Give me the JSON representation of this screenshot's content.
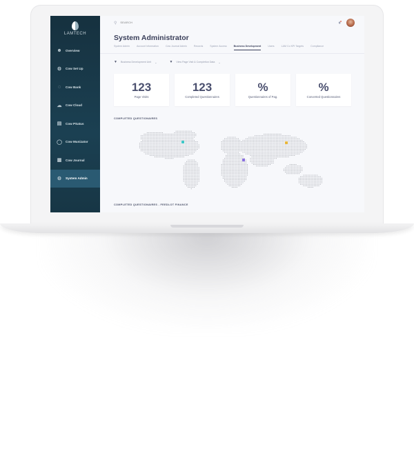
{
  "app": {
    "logo_text": "LAMTECH"
  },
  "sidebar": {
    "items": [
      {
        "label": "Overview",
        "icon": "person-icon"
      },
      {
        "label": "Cow Set Up",
        "icon": "cow-icon"
      },
      {
        "label": "Cow Bank",
        "icon": "piggy-bank-icon"
      },
      {
        "label": "Cow Cloud",
        "icon": "cloud-icon"
      },
      {
        "label": "Cow PSatus",
        "icon": "document-icon"
      },
      {
        "label": "Cow Munizator",
        "icon": "chat-icon"
      },
      {
        "label": "Cow Journal",
        "icon": "journal-icon"
      },
      {
        "label": "System Admin",
        "icon": "gear-icon",
        "active": true
      }
    ]
  },
  "topbar": {
    "search_placeholder": "SEARCH"
  },
  "page": {
    "title": "System Administrator"
  },
  "tabs": [
    {
      "label": "System Admin"
    },
    {
      "label": "Account Information"
    },
    {
      "label": "Cow Journal Admin"
    },
    {
      "label": "Records"
    },
    {
      "label": "System Access"
    },
    {
      "label": "Business Development",
      "active": true
    },
    {
      "label": "Users"
    },
    {
      "label": "LAM Co KPI Targets"
    },
    {
      "label": "Compliance"
    }
  ],
  "filters": [
    {
      "label": "Business Development Unit"
    },
    {
      "label": "View Page Visit & Completion Data"
    }
  ],
  "cards": [
    {
      "value": "123",
      "label": "Page Visits"
    },
    {
      "value": "123",
      "label": "Completed Questionnaires"
    },
    {
      "value": "%",
      "label": "Questionnaires of Pag."
    },
    {
      "value": "%",
      "label": "Converted Questionnaires"
    }
  ],
  "sections": {
    "completed_title": "COMPLETED QUESTIONAIRES",
    "feedlot_title": "COMPLETED QUESTIONAIRES - FEEDLOT FINANCE"
  },
  "map_markers": [
    {
      "color": "#3fc8c8"
    },
    {
      "color": "#e8b63a"
    },
    {
      "color": "#8a6fe0"
    }
  ],
  "colors": {
    "sidebar": "#1b4052",
    "sidebar_active": "#2a5a72",
    "text_dark": "#3a3f5a",
    "map_dots": "#9a9ca4"
  }
}
